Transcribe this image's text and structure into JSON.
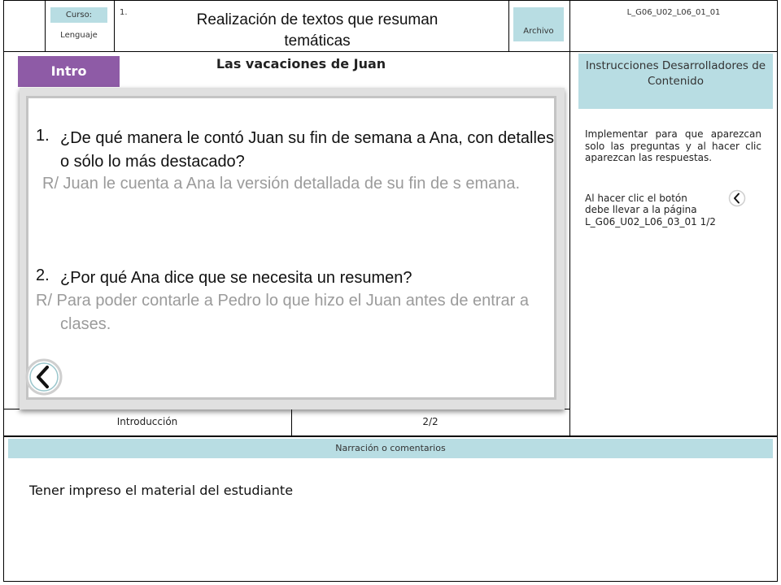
{
  "header": {
    "curso_label": "Curso:",
    "curso_value": "Lenguaje",
    "number": "1.",
    "title": "Realización de textos que resuman temáticas",
    "archivo_label": "Archivo",
    "file_code": "L_G06_U02_L06_01_01"
  },
  "slide": {
    "intro_tab": "Intro",
    "title": "Las vacaciones de Juan",
    "q1_number": "1.",
    "q1_text": "¿De qué manera le contó Juan su fin de semana a  Ana, con detalles o sólo lo más destacado?",
    "a1_text": "R/ Juan le cuenta a Ana la versión detallada de su fin de s emana.",
    "q2_number": "2.",
    "q2_text": "¿Por qué Ana dice que se necesita un resumen?",
    "a2_text": "R/ Para poder contarle a Pedro lo que hizo el Juan antes de entrar a clases."
  },
  "footer_row": {
    "section": "Introducción",
    "page": "2/2"
  },
  "instructions": {
    "header": "Instrucciones Desarrolladores de Contenido",
    "para1": "Implementar para que aparezcan solo las preguntas y al hacer clic aparezcan las respuestas.",
    "para2_line1": "Al hacer clic el botón",
    "para2_line2": "debe llevar a la página",
    "para2_line3": "L_G06_U02_L06_03_01 1/2"
  },
  "narration": {
    "header": "Narración o comentarios",
    "text": "Tener impreso el material del estudiante"
  },
  "colors": {
    "teal": "#b8dde3",
    "purple": "#8e5ba6",
    "answer_gray": "#9b9b9b"
  }
}
